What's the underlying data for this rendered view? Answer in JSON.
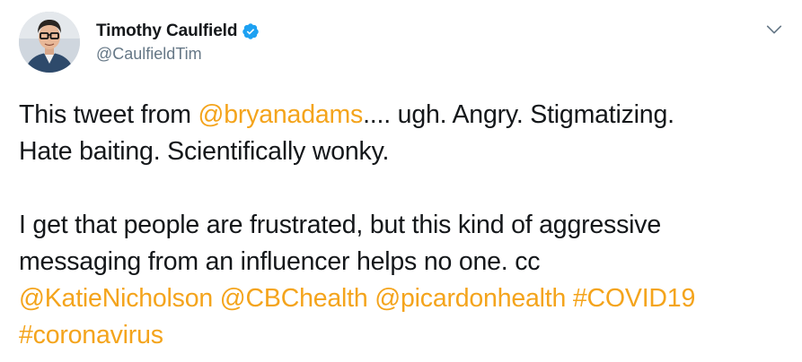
{
  "author": {
    "display_name": "Timothy Caulfield",
    "handle": "@CaulfieldTim",
    "verified": true
  },
  "icons": {
    "verified": "verified-badge-icon",
    "menu": "chevron-down-icon"
  },
  "colors": {
    "link": "#f4a41c",
    "text": "#14171a",
    "handle": "#657786",
    "verified": "#1da1f2"
  },
  "tweet": {
    "p1": {
      "t1": "This tweet from ",
      "mention1": "@bryanadams",
      "t2": ".... ugh. Angry. Stigmatizing.",
      "t3": "Hate baiting. Scientifically wonky."
    },
    "p2": {
      "t1": "I get that people are frustrated, but this kind of aggressive",
      "t2": "messaging from an influencer helps no one. cc",
      "mention2": "@KatieNicholson",
      "mention3": "@CBChealth",
      "mention4": "@picardonhealth",
      "hashtag1": "#COVID19",
      "hashtag2": "#coronavirus"
    }
  }
}
